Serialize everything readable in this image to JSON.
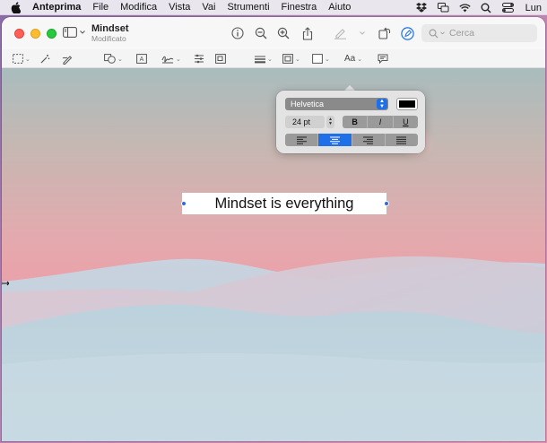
{
  "menubar": {
    "app_name": "Anteprima",
    "items": [
      "File",
      "Modifica",
      "Vista",
      "Vai",
      "Strumenti",
      "Finestra",
      "Aiuto"
    ],
    "clock": "Lun"
  },
  "window": {
    "title": "Mindset",
    "subtitle": "Modificato",
    "search_placeholder": "Cerca"
  },
  "markup_toolbar": {
    "text_style_label": "Aa"
  },
  "font_panel": {
    "font_family": "Helvetica",
    "font_size": "24 pt",
    "text_color": "#000000",
    "bold_label": "B",
    "italic_label": "I",
    "underline_label": "U",
    "alignment_selected": "center"
  },
  "document": {
    "text_annotation": "Mindset is everything"
  },
  "colors": {
    "accent": "#1f6fe8",
    "traffic_close": "#fe5f57",
    "traffic_minimize": "#febc2e",
    "traffic_maximize": "#28c840"
  }
}
